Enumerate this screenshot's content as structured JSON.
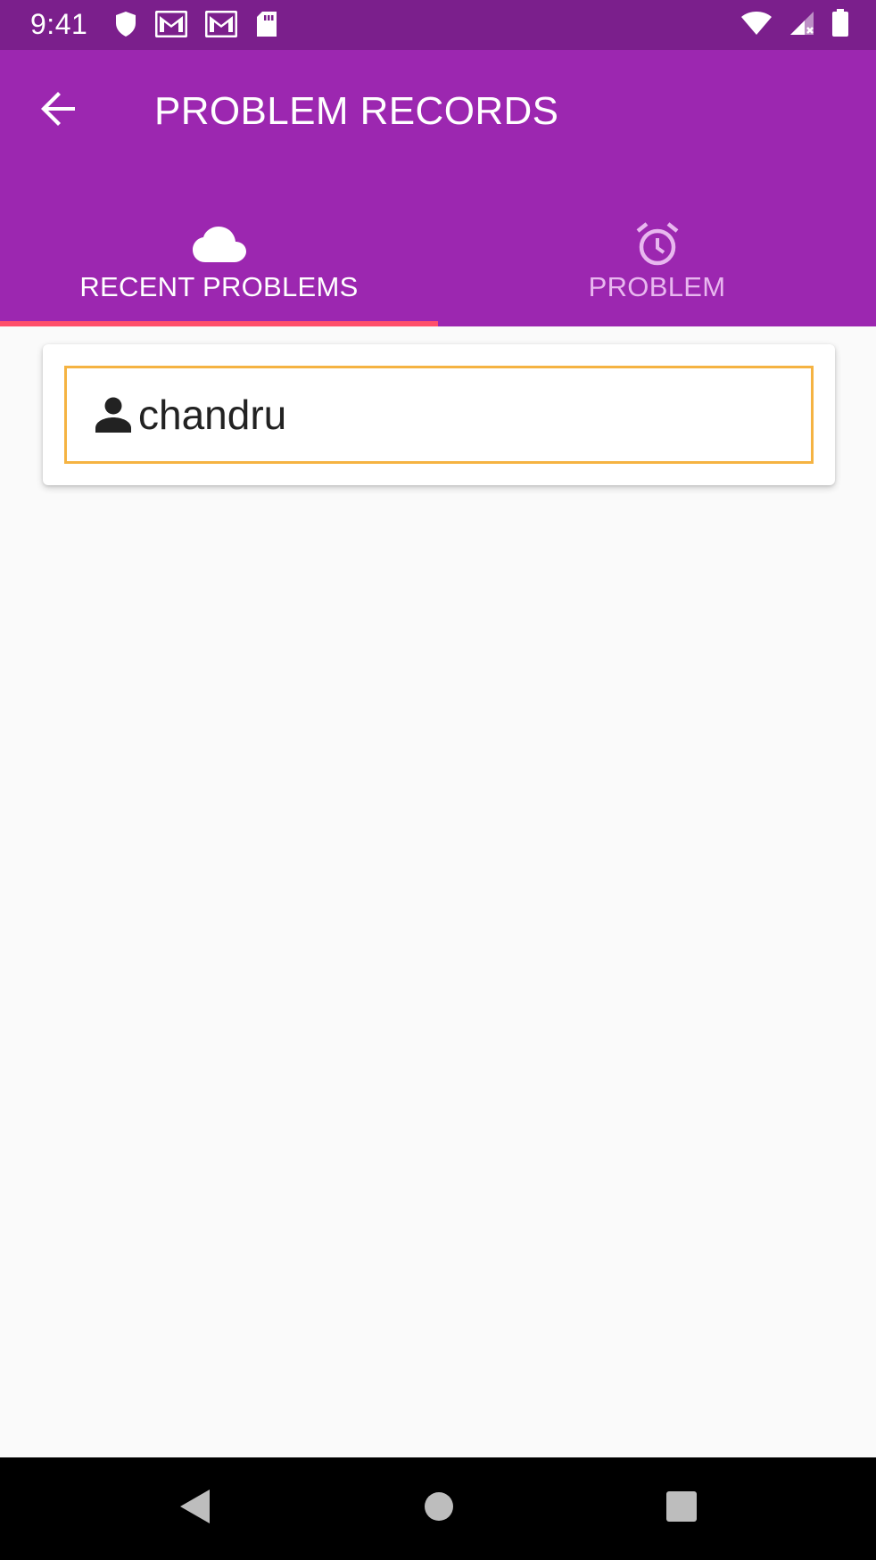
{
  "status_bar": {
    "time": "9:41",
    "left_icons": [
      "shield-icon",
      "gmail-icon",
      "gmail-icon",
      "sd-card-icon"
    ],
    "right_icons": [
      "wifi-icon",
      "cell-signal-icon",
      "battery-icon"
    ]
  },
  "app_bar": {
    "title": "PROBLEM RECORDS",
    "back_icon": "arrow-back-icon",
    "color": "#9c27b0"
  },
  "tabs": [
    {
      "label": "RECENT PROBLEMS",
      "icon": "cloud-icon",
      "selected": true
    },
    {
      "label": "PROBLEM",
      "icon": "alarm-icon",
      "selected": false
    }
  ],
  "tab_indicator_color": "#ff4f6a",
  "records": [
    {
      "icon": "person-icon",
      "name": "chandru"
    }
  ],
  "nav_bar": {
    "buttons": [
      "back-triangle-icon",
      "home-circle-icon",
      "recents-square-icon"
    ]
  }
}
